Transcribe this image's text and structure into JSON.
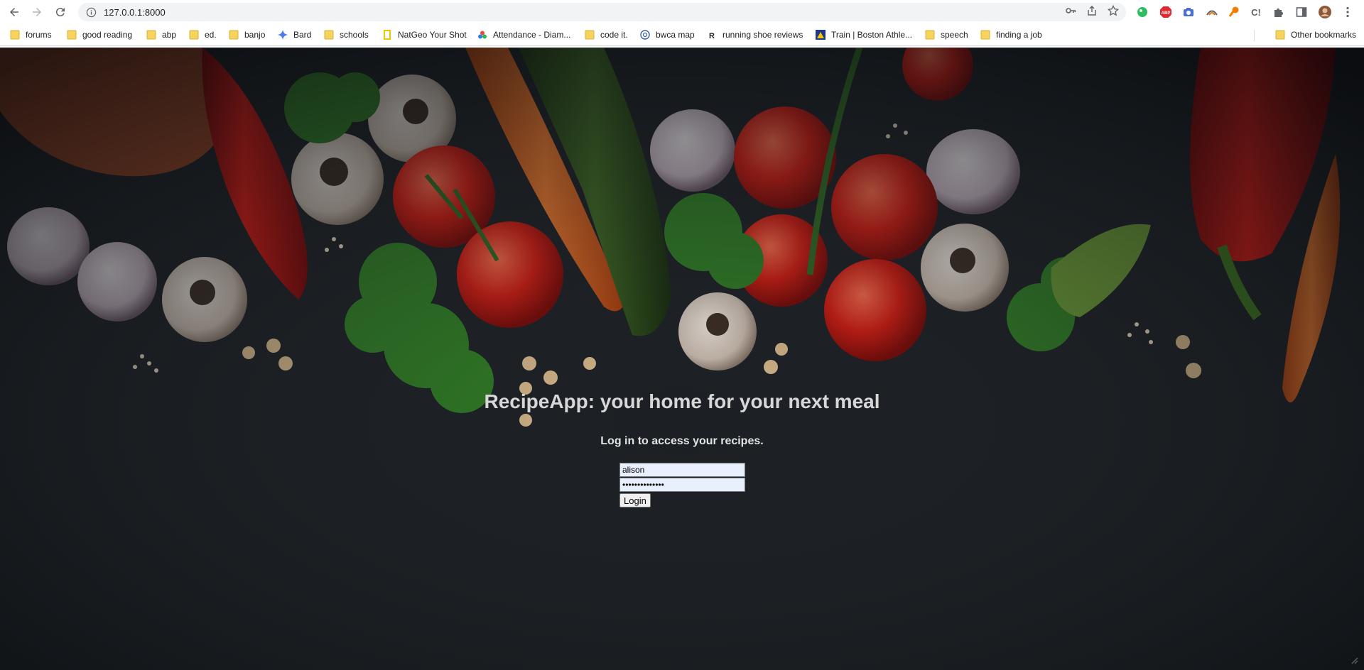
{
  "browser": {
    "url": "127.0.0.1:8000",
    "bookmarks": [
      {
        "label": "forums",
        "icon": "folder-icon"
      },
      {
        "label": "good reading",
        "icon": "folder-icon"
      },
      {
        "label": "abp",
        "icon": "folder-icon"
      },
      {
        "label": "ed.",
        "icon": "folder-icon"
      },
      {
        "label": "banjo",
        "icon": "folder-icon"
      },
      {
        "label": "Bard",
        "icon": "bard-sparkle-icon"
      },
      {
        "label": "schools",
        "icon": "folder-icon"
      },
      {
        "label": "NatGeo Your Shot",
        "icon": "natgeo-icon"
      },
      {
        "label": "Attendance - Diam...",
        "icon": "attendance-icon"
      },
      {
        "label": "code it.",
        "icon": "folder-icon"
      },
      {
        "label": "bwca map",
        "icon": "globe-icon"
      },
      {
        "label": "running shoe reviews",
        "icon": "runrepeat-icon"
      },
      {
        "label": "Train | Boston Athle...",
        "icon": "baa-unicorn-icon"
      },
      {
        "label": "speech",
        "icon": "folder-icon"
      },
      {
        "label": "finding a job",
        "icon": "folder-icon"
      }
    ],
    "other_bookmarks": "Other bookmarks",
    "colors": {
      "folder": "#f6d35d",
      "toolbar_bg": "#ffffff",
      "omnibox_bg": "#f1f3f4"
    }
  },
  "page": {
    "title": "RecipeApp: your home for your next meal",
    "subtitle": "Log in to access your recipes.",
    "username_value": "alison",
    "password_value": "••••••••••••••",
    "login_label": "Login"
  }
}
